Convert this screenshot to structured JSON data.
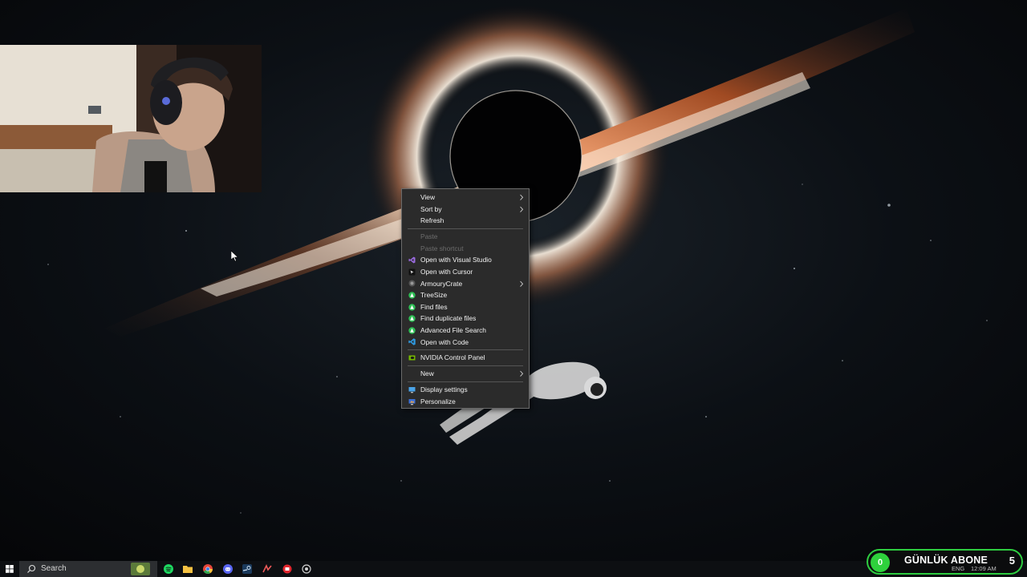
{
  "desktop": {
    "context_menu": {
      "items": [
        {
          "label": "View",
          "submenu": true
        },
        {
          "label": "Sort by",
          "submenu": true
        },
        {
          "label": "Refresh"
        },
        {
          "label": "Paste",
          "disabled": true
        },
        {
          "label": "Paste shortcut",
          "disabled": true
        },
        {
          "label": "Open with Visual Studio",
          "icon": "visual-studio-icon"
        },
        {
          "label": "Open with Cursor",
          "icon": "cursor-app-icon"
        },
        {
          "label": "ArmouryCrate",
          "icon": "armoury-crate-icon",
          "submenu": true
        },
        {
          "label": "TreeSize",
          "icon": "treesize-icon"
        },
        {
          "label": "Find files",
          "icon": "treesize-find-icon"
        },
        {
          "label": "Find duplicate files",
          "icon": "treesize-duplicate-icon"
        },
        {
          "label": "Advanced File Search",
          "icon": "treesize-search-icon"
        },
        {
          "label": "Open with Code",
          "icon": "vscode-icon"
        },
        {
          "label": "NVIDIA Control Panel",
          "icon": "nvidia-icon"
        },
        {
          "label": "New",
          "submenu": true
        },
        {
          "label": "Display settings",
          "icon": "display-settings-icon"
        },
        {
          "label": "Personalize",
          "icon": "personalize-icon"
        }
      ]
    }
  },
  "taskbar": {
    "search_label": "Search",
    "apps": [
      "spotify-icon",
      "file-explorer-icon",
      "chrome-icon",
      "discord-icon",
      "steam-icon",
      "app-icon",
      "recording-icon",
      "settings-icon"
    ],
    "language": "ENG",
    "time": "12:09 AM"
  },
  "subscriber_widget": {
    "badge": "0",
    "label": "GÜNLÜK ABONE",
    "count": "5"
  },
  "colors": {
    "menu_bg": "#2b2b2b",
    "menu_border": "#6b6b6b",
    "widget_accent": "#2ecc40",
    "taskbar_bg": "#0d0f12"
  }
}
